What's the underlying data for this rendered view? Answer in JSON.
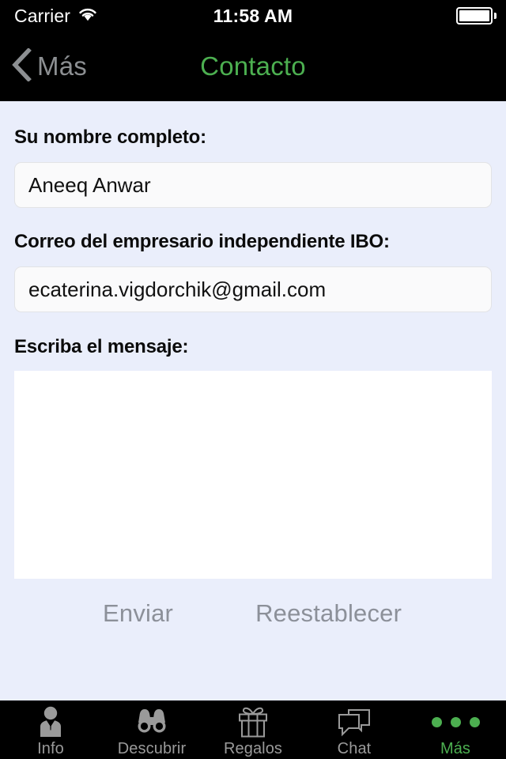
{
  "status_bar": {
    "carrier": "Carrier",
    "wifi_icon": "wifi-icon",
    "time": "11:58 AM",
    "battery_icon": "battery-full-icon"
  },
  "nav_bar": {
    "back_icon": "chevron-left-icon",
    "back_label": "Más",
    "title": "Contacto",
    "title_color": "#4CAF50",
    "back_color": "#8C8F92",
    "background": "#000000"
  },
  "form": {
    "background": "#EAEEFB",
    "fields": [
      {
        "label": "Su nombre completo:",
        "value": "Aneeq Anwar",
        "placeholder": "Su nombre completo"
      },
      {
        "label": "Correo del empresario independiente IBO:",
        "value": "ecaterina.vigdorchik@gmail.com",
        "placeholder": "Correo del empresario independiente IBO"
      }
    ],
    "message": {
      "label": "Escriba el mensaje:",
      "value": "",
      "placeholder": ""
    },
    "buttons": [
      {
        "label": "Enviar",
        "name": "send-button"
      },
      {
        "label": "Reestablecer",
        "name": "reset-button"
      }
    ],
    "button_color": "#8C9099"
  },
  "tab_bar": {
    "background": "#000000",
    "active_color": "#4CAF50",
    "inactive_color": "#9A9A9A",
    "items": [
      {
        "label": "Info",
        "icon": "businessman-icon",
        "active": false
      },
      {
        "label": "Descubrir",
        "icon": "binoculars-icon",
        "active": false
      },
      {
        "label": "Regalos",
        "icon": "gift-icon",
        "active": false
      },
      {
        "label": "Chat",
        "icon": "speech-bubbles-icon",
        "active": false
      },
      {
        "label": "Más",
        "icon": "three-dots-icon",
        "active": true
      }
    ]
  }
}
